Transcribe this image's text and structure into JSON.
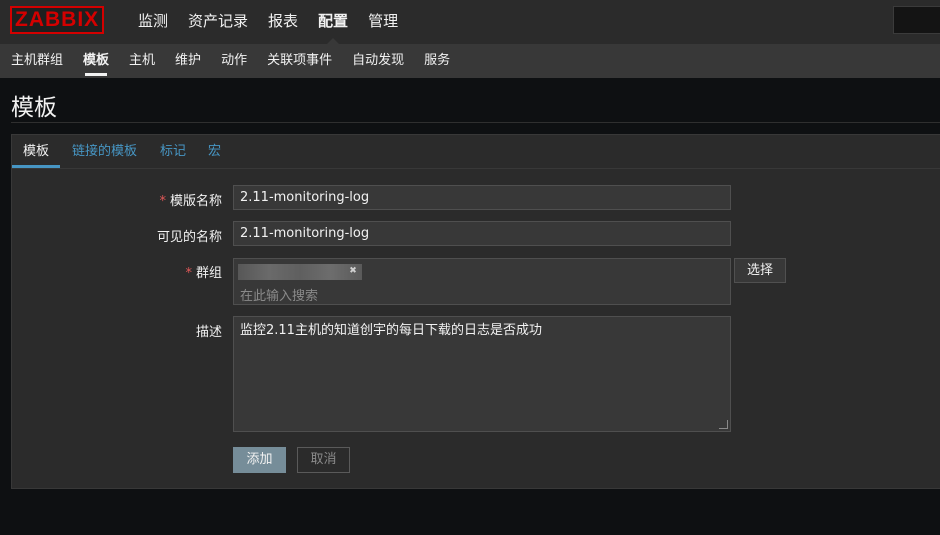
{
  "app": {
    "logo": "ZABBIX"
  },
  "main_nav": [
    "监测",
    "资产记录",
    "报表",
    "配置",
    "管理"
  ],
  "sub_nav": [
    "主机群组",
    "模板",
    "主机",
    "维护",
    "动作",
    "关联项事件",
    "自动发现",
    "服务"
  ],
  "page_title": "模板",
  "tabs": [
    "模板",
    "链接的模板",
    "标记",
    "宏"
  ],
  "form": {
    "template_name": {
      "label": "模版名称",
      "value": "2.11-monitoring-log",
      "required": true
    },
    "visible_name": {
      "label": "可见的名称",
      "value": "2.11-monitoring-log"
    },
    "groups": {
      "label": "群组",
      "placeholder": "在此输入搜索",
      "select_label": "选择",
      "required": true
    },
    "description": {
      "label": "描述",
      "value": "监控2.11主机的知道创宇的每日下载的日志是否成功"
    }
  },
  "buttons": {
    "add": "添加",
    "cancel": "取消"
  },
  "colors": {
    "brand": "#d40000",
    "link": "#4796c4",
    "required": "#e45959",
    "primary_button": "#768d99"
  }
}
